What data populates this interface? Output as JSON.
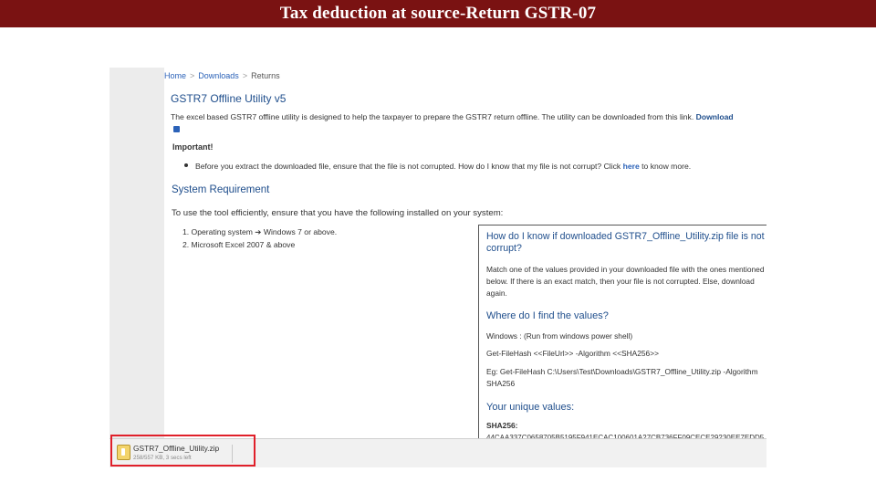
{
  "slide": {
    "title": "Tax deduction at source-Return GSTR-07"
  },
  "breadcrumb": {
    "items": [
      "Home",
      "Downloads",
      "Returns"
    ],
    "separator": ">"
  },
  "page": {
    "heading": "GSTR7 Offline Utility v5",
    "description": "The excel based GSTR7 offline utility is designed to help the taxpayer to prepare the GSTR7 return offline. The utility can be downloaded from this link.",
    "download_link": "Download",
    "important_label": "Important!",
    "bullet_text": "Before you extract the downloaded file, ensure that the file is not corrupted. How do I know that my file is not corrupt? Click",
    "bullet_link": "here",
    "bullet_tail": "to know more.",
    "system_heading": "System Requirement",
    "system_intro": "To use the tool efficiently, ensure that you have the following installed on your system:",
    "requirements": [
      "1. Operating system ➔ Windows 7 or above.",
      "2. Microsoft Excel 2007 & above"
    ]
  },
  "popup": {
    "title": "How do I know if downloaded GSTR7_Offline_Utility.zip file is not corrupt?",
    "intro": "Match one of the values provided in your downloaded file with the ones mentioned below. If there is an exact match, then your file is not corrupted. Else, download again.",
    "find_heading": "Where do I find the values?",
    "windows_line": "Windows : (Run from windows power shell)",
    "command_line": "Get-FileHash <<FileUrl>> -Algorithm <<SHA256>>",
    "example_line": "Eg: Get-FileHash C:\\Users\\Test\\Downloads\\GSTR7_Offline_Utility.zip -Algorithm SHA256",
    "unique_heading": "Your unique values:",
    "sha_label": "SHA256:",
    "sha_value": "44CAA337C0658705B5195F941ECAC100601A27CB736FF09CECE29230EE7EDD5"
  },
  "download_bar": {
    "file_name": "GSTR7_Offline_Utility.zip",
    "file_status": "258/557 KB, 3 secs left",
    "highlight_color": "#e0202a"
  },
  "colors": {
    "title_bar": "#7a1212",
    "heading_blue": "#1f4e8c",
    "link_blue": "#2b62b8"
  }
}
